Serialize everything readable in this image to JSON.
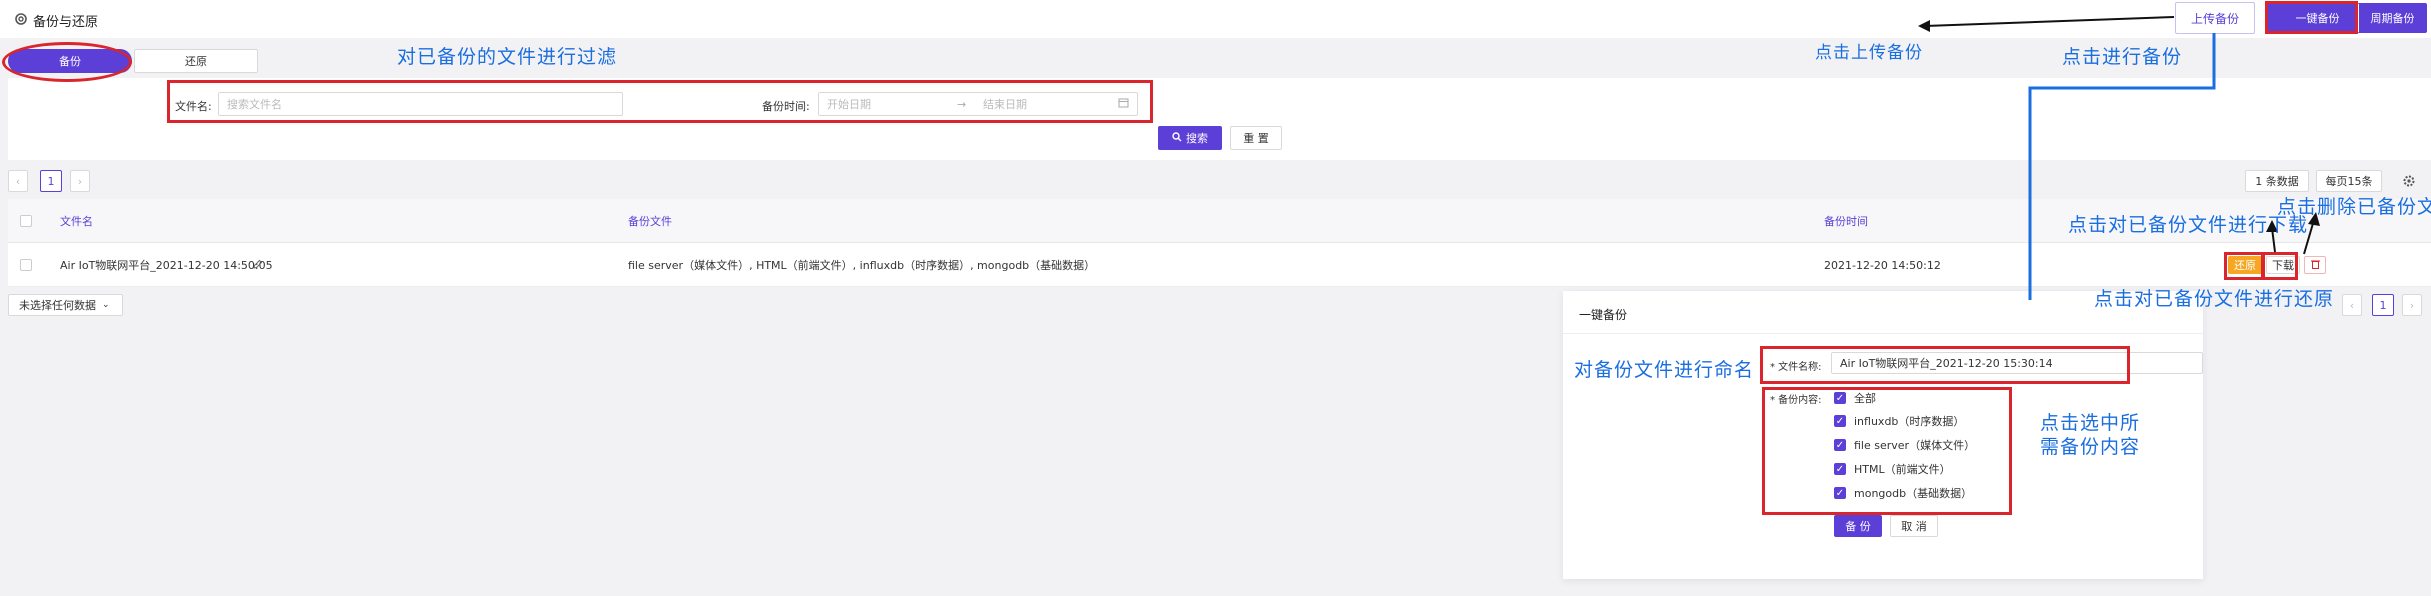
{
  "page": {
    "title": "备份与还原"
  },
  "toolbar": {
    "upload": "上传备份",
    "one_click": "一键备份",
    "periodic": "周期备份"
  },
  "tabs": [
    {
      "label": "备份"
    },
    {
      "label": "还原"
    }
  ],
  "filter": {
    "file_label": "文件名:",
    "file_placeholder": "搜索文件名",
    "time_label": "备份时间:",
    "start_placeholder": "开始日期",
    "separator": "→",
    "end_placeholder": "结束日期",
    "search": "搜索",
    "reset": "重 置"
  },
  "pagination": {
    "page": "1",
    "total": "1 条数据",
    "per_page": "每页15条"
  },
  "table": {
    "headers": {
      "name": "文件名",
      "file": "备份文件",
      "time": "备份时间"
    },
    "rows": [
      {
        "name": "Air IoT物联网平台_2021-12-20 14:50:05",
        "files": "file server（媒体文件）, HTML（前端文件）, influxdb（时序数据）, mongodb（基础数据）",
        "time": "2021-12-20 14:50:12",
        "restore": "还原",
        "download": "下载"
      }
    ]
  },
  "footer": {
    "selection": "未选择任何数据"
  },
  "modal": {
    "title": "一键备份",
    "name_label": "* 文件名称:",
    "name_value": "Air IoT物联网平台_2021-12-20 15:30:14",
    "content_label": "* 备份内容:",
    "options": [
      {
        "label": "全部"
      },
      {
        "label": "influxdb（时序数据）"
      },
      {
        "label": "file server（媒体文件）"
      },
      {
        "label": "HTML（前端文件）"
      },
      {
        "label": "mongodb（基础数据）"
      }
    ],
    "submit": "备 份",
    "cancel": "取 消"
  },
  "annotations": {
    "filter": "对已备份的文件进行过滤",
    "upload": "点击上传备份",
    "backup": "点击进行备份",
    "download": "点击对已备份文件进行下载",
    "delete": "点击删除已备份文",
    "restore": "点击对已备份文件进行还原",
    "naming": "对备份文件进行命名",
    "select_line1": "点击选中所",
    "select_line2": "需备份内容"
  },
  "colors": {
    "primary": "#5b3fd6",
    "annotation": "#1a6ee0",
    "highlight": "#d9252b",
    "restore_button": "#f5a623"
  }
}
